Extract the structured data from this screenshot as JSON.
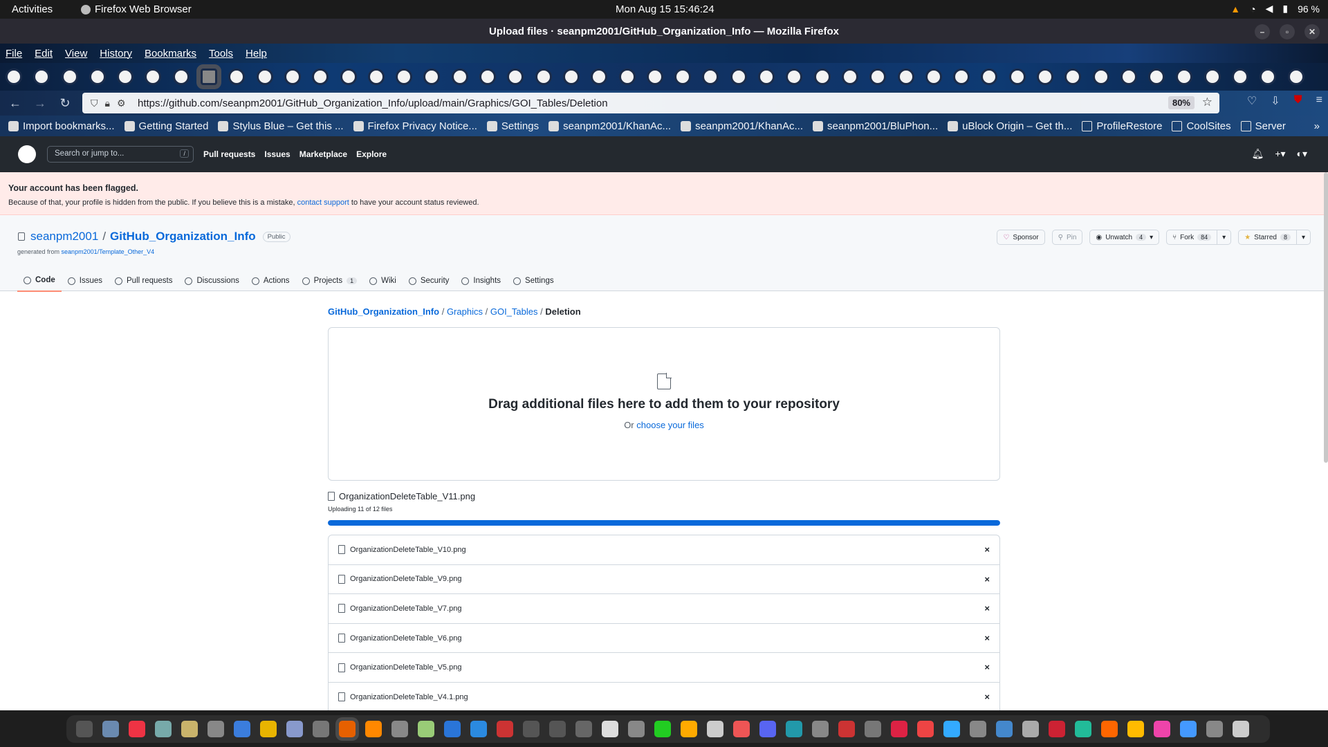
{
  "system": {
    "activities": "Activities",
    "app_name": "Firefox Web Browser",
    "clock": "Mon Aug 15  15:46:24",
    "battery": "96 %"
  },
  "window": {
    "title": "Upload files · seanpm2001/GitHub_Organization_Info — Mozilla Firefox"
  },
  "menu": [
    "File",
    "Edit",
    "View",
    "History",
    "Bookmarks",
    "Tools",
    "Help"
  ],
  "pinned_tab_count": 47,
  "navbar": {
    "url": "https://github.com/seanpm2001/GitHub_Organization_Info/upload/main/Graphics/GOI_Tables/Deletion",
    "zoom": "80%"
  },
  "bookmarks": [
    {
      "label": "Import bookmarks...",
      "icon": "import-icon"
    },
    {
      "label": "Getting Started",
      "icon": "firefox-icon"
    },
    {
      "label": "Stylus Blue – Get this ...",
      "icon": "stylus-icon"
    },
    {
      "label": "Firefox Privacy Notice...",
      "icon": "mozilla-icon"
    },
    {
      "label": "Settings",
      "icon": "gear-icon"
    },
    {
      "label": "seanpm2001/KhanAc...",
      "icon": "github-icon"
    },
    {
      "label": "seanpm2001/KhanAc...",
      "icon": "github-icon"
    },
    {
      "label": "seanpm2001/BluPhon...",
      "icon": "github-icon"
    },
    {
      "label": "uBlock Origin – Get th...",
      "icon": "ublock-icon"
    },
    {
      "label": "ProfileRestore",
      "icon": "folder-icon"
    },
    {
      "label": "CoolSites",
      "icon": "folder-icon"
    },
    {
      "label": "Server",
      "icon": "folder-icon"
    }
  ],
  "github": {
    "search_placeholder": "Search or jump to...",
    "search_key": "/",
    "nav": [
      "Pull requests",
      "Issues",
      "Marketplace",
      "Explore"
    ]
  },
  "flag": {
    "title": "Your account has been flagged.",
    "text_before": "Because of that, your profile is hidden from the public. If you believe this is a mistake, ",
    "link": "contact support",
    "text_after": " to have your account status reviewed."
  },
  "repo": {
    "owner": "seanpm2001",
    "sep": "/",
    "name": "GitHub_Organization_Info",
    "visibility": "Public",
    "generated_prefix": "generated from ",
    "generated_link": "seanpm2001/Template_Other_V4",
    "actions": {
      "sponsor": "Sponsor",
      "pin": "Pin",
      "unwatch": "Unwatch",
      "watch_count": "4",
      "fork": "Fork",
      "fork_count": "84",
      "starred": "Starred",
      "star_count": "8"
    },
    "tabs": [
      {
        "label": "Code",
        "count": ""
      },
      {
        "label": "Issues",
        "count": ""
      },
      {
        "label": "Pull requests",
        "count": ""
      },
      {
        "label": "Discussions",
        "count": ""
      },
      {
        "label": "Actions",
        "count": ""
      },
      {
        "label": "Projects",
        "count": "1"
      },
      {
        "label": "Wiki",
        "count": ""
      },
      {
        "label": "Security",
        "count": ""
      },
      {
        "label": "Insights",
        "count": ""
      },
      {
        "label": "Settings",
        "count": ""
      }
    ]
  },
  "breadcrumb": {
    "repo": "GitHub_Organization_Info",
    "sep": "/",
    "p1": "Graphics",
    "p2": "GOI_Tables",
    "current": "Deletion"
  },
  "dropzone": {
    "title": "Drag additional files here to add them to your repository",
    "or": "Or ",
    "link": "choose your files"
  },
  "upload": {
    "current_file": "OrganizationDeleteTable_V11.png",
    "status": "Uploading 11 of 12 files",
    "progress": 1.0
  },
  "files": [
    "OrganizationDeleteTable_V10.png",
    "OrganizationDeleteTable_V9.png",
    "OrganizationDeleteTable_V7.png",
    "OrganizationDeleteTable_V6.png",
    "OrganizationDeleteTable_V5.png",
    "OrganizationDeleteTable_V4.1.png"
  ],
  "remove_symbol": "×",
  "dock_app_count": 45
}
